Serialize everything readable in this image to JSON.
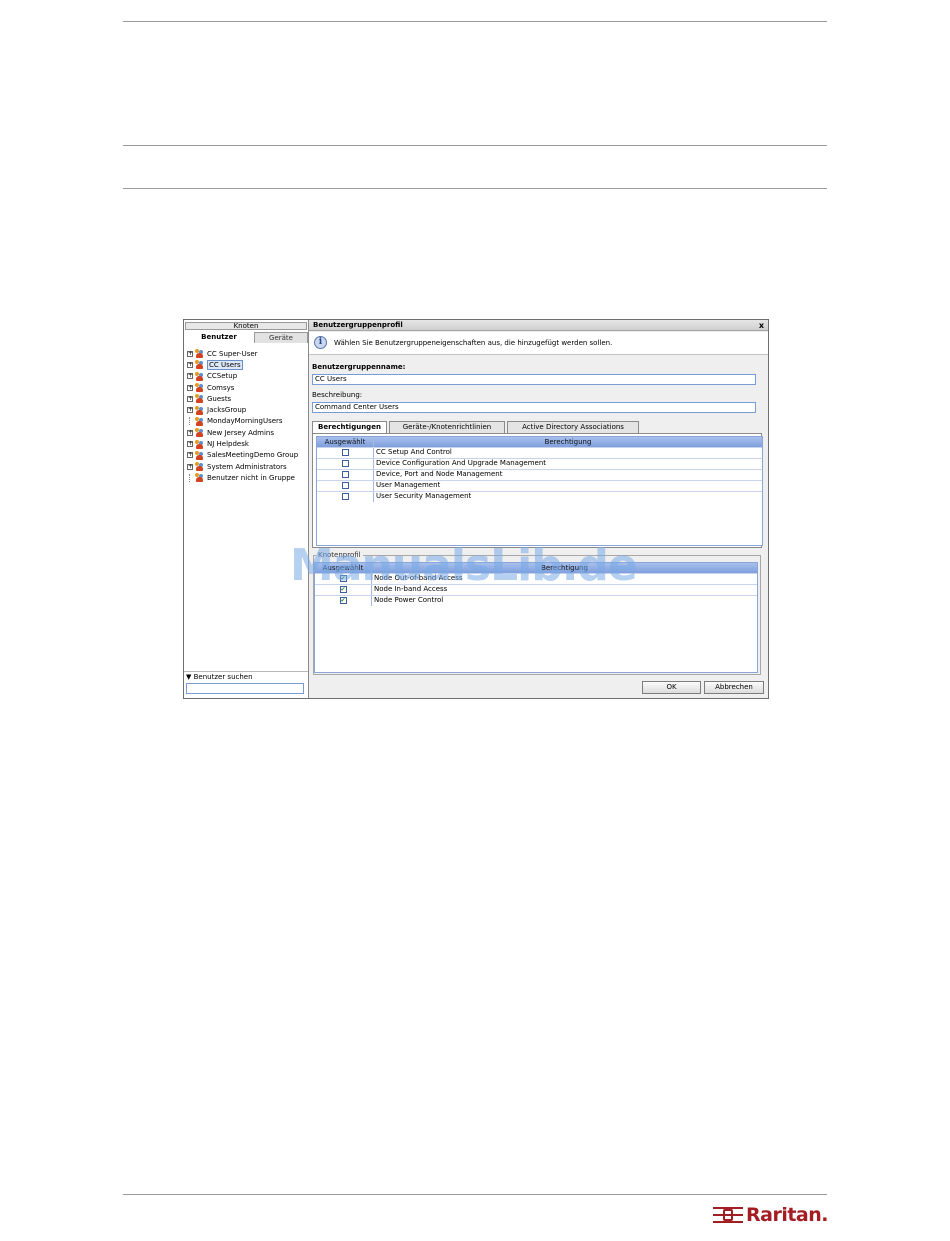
{
  "watermark": "ManualsLib.de",
  "logo": {
    "text": "Raritan."
  },
  "left_pane": {
    "knoten_tab": "Knoten",
    "tabs": {
      "benutzer": "Benutzer",
      "geraete": "Geräte"
    },
    "tree": [
      {
        "label": "CC Super-User",
        "expandable": true,
        "selected": false
      },
      {
        "label": "CC Users",
        "expandable": true,
        "selected": true
      },
      {
        "label": "CCSetup",
        "expandable": true,
        "selected": false
      },
      {
        "label": "Comsys",
        "expandable": true,
        "selected": false
      },
      {
        "label": "Guests",
        "expandable": true,
        "selected": false
      },
      {
        "label": "JacksGroup",
        "expandable": true,
        "selected": false
      },
      {
        "label": "MondayMorningUsers",
        "expandable": false,
        "selected": false
      },
      {
        "label": "New Jersey Admins",
        "expandable": true,
        "selected": false
      },
      {
        "label": "NJ Helpdesk",
        "expandable": true,
        "selected": false
      },
      {
        "label": "SalesMeetingDemo Group",
        "expandable": true,
        "selected": false
      },
      {
        "label": "System Administrators",
        "expandable": true,
        "selected": false
      },
      {
        "label": "Benutzer nicht in Gruppe",
        "expandable": false,
        "selected": false
      }
    ],
    "search_label": "▼ Benutzer suchen",
    "search_value": ""
  },
  "dialog": {
    "title": "Benutzergruppenprofil",
    "close": "x",
    "info_text": "Wählen Sie Benutzergruppeneigenschaften aus, die hinzugefügt werden sollen.",
    "name_label": "Benutzergruppenname:",
    "name_value": "CC Users",
    "desc_label": "Beschreibung:",
    "desc_value": "Command Center Users",
    "tabs": [
      "Berechtigungen",
      "Geräte-/Knotenrichtlinien",
      "Active Directory Associations"
    ],
    "permissions": {
      "headers": [
        "Ausgewählt",
        "Berechtigung"
      ],
      "rows": [
        {
          "label": "CC Setup And Control",
          "checked": false
        },
        {
          "label": "Device Configuration And Upgrade Management",
          "checked": false
        },
        {
          "label": "Device, Port and Node Management",
          "checked": false
        },
        {
          "label": "User Management",
          "checked": false
        },
        {
          "label": "User Security Management",
          "checked": false
        }
      ]
    },
    "node_profile": {
      "legend": "Knotenprofil",
      "headers": [
        "Ausgewählt",
        "Berechtigung"
      ],
      "rows": [
        {
          "label": "Node Out-of-band Access",
          "checked": true
        },
        {
          "label": "Node In-band Access",
          "checked": true
        },
        {
          "label": "Node Power Control",
          "checked": true
        }
      ]
    },
    "ok": "OK",
    "cancel": "Abbrechen"
  }
}
